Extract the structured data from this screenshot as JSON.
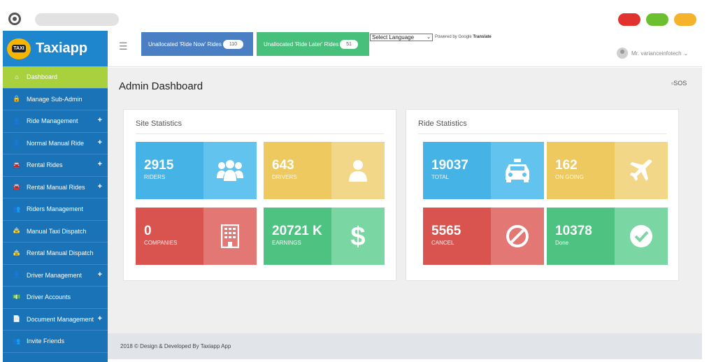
{
  "brand": {
    "name": "Taxiapp",
    "badge": "TAXI"
  },
  "sidebar": {
    "items": [
      {
        "label": "Dashboard",
        "icon": "home-icon",
        "glyph": "⌂",
        "active": true,
        "expandable": false
      },
      {
        "label": "Manage Sub-Admin",
        "icon": "lock-icon",
        "glyph": "🔒",
        "active": false,
        "expandable": false
      },
      {
        "label": "Ride Management",
        "icon": "user-icon",
        "glyph": "👤",
        "active": false,
        "expandable": true
      },
      {
        "label": "Normal Manual Ride",
        "icon": "user-icon",
        "glyph": "👤",
        "active": false,
        "expandable": true
      },
      {
        "label": "Rental Rides",
        "icon": "car-icon",
        "glyph": "🚘",
        "active": false,
        "expandable": true
      },
      {
        "label": "Rental Manual Rides",
        "icon": "car-icon",
        "glyph": "🚘",
        "active": false,
        "expandable": true
      },
      {
        "label": "Riders Management",
        "icon": "users-icon",
        "glyph": "👥",
        "active": false,
        "expandable": false
      },
      {
        "label": "Manual Taxi Dispatch",
        "icon": "taxi-icon",
        "glyph": "🚖",
        "active": false,
        "expandable": false
      },
      {
        "label": "Rental Manual Dispatch",
        "icon": "taxi-icon",
        "glyph": "🚖",
        "active": false,
        "expandable": false
      },
      {
        "label": "Driver Management",
        "icon": "user-icon",
        "glyph": "👤",
        "active": false,
        "expandable": true
      },
      {
        "label": "Driver Accounts",
        "icon": "money-icon",
        "glyph": "💵",
        "active": false,
        "expandable": false
      },
      {
        "label": "Document Management",
        "icon": "file-icon",
        "glyph": "📄",
        "active": false,
        "expandable": true
      },
      {
        "label": "Invite Friends",
        "icon": "users-icon",
        "glyph": "👥",
        "active": false,
        "expandable": false
      }
    ],
    "plus_glyph": "+"
  },
  "topbar": {
    "menu_glyph": "☰",
    "ride_now": {
      "label": "Unallocated 'Ride Now' Rides",
      "count": "110"
    },
    "ride_later": {
      "label": "Unallocated 'Ride Later' Rides",
      "count": "51"
    },
    "language": {
      "selected": "Select Language",
      "chevron": "⌄"
    },
    "powered_by": "Powered by",
    "google": "Google",
    "translate": "Translate",
    "user": "Mr. varianceinfotech",
    "user_chevron": "⌄"
  },
  "main": {
    "title": "Admin Dashboard",
    "sos": "SOS",
    "site_statistics": {
      "title": "Site Statistics",
      "cards": [
        {
          "value": "2915",
          "label": "RIDERS",
          "icon": "users-icon",
          "color": "blue"
        },
        {
          "value": "643",
          "label": "DRIVERS",
          "icon": "user-icon",
          "color": "yellow"
        },
        {
          "value": "0",
          "label": "COMPANIES",
          "icon": "building-icon",
          "color": "red"
        },
        {
          "value": "20721 K",
          "label": "EARNINGS",
          "icon": "dollar-icon",
          "color": "green"
        }
      ]
    },
    "ride_statistics": {
      "title": "Ride Statistics",
      "cards": [
        {
          "value": "19037",
          "label": "TOTAL",
          "icon": "taxi-icon",
          "color": "blue"
        },
        {
          "value": "162",
          "label": "ON GOING",
          "icon": "plane-icon",
          "color": "yellow"
        },
        {
          "value": "5565",
          "label": "CANCEL",
          "icon": "ban-icon",
          "color": "red"
        },
        {
          "value": "10378",
          "label": "Done",
          "icon": "check-circle-icon",
          "color": "green"
        }
      ]
    }
  },
  "footer": {
    "text": "2018 © Design & Developed By Taxiapp App"
  },
  "colors": {
    "sidebar": "#1a73b7",
    "active": "#a8d13d",
    "blue": "#46b3e6",
    "yellow": "#eec95f",
    "red": "#d9534f",
    "green": "#4ec381"
  }
}
